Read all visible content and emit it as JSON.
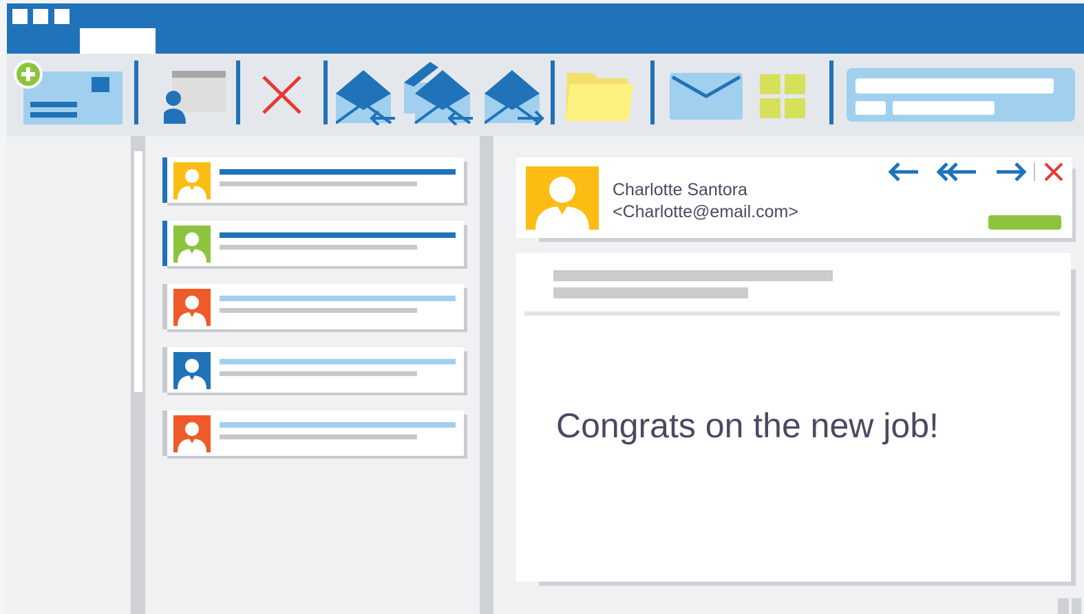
{
  "colors": {
    "chrome_blue": "#2072b9",
    "light_blue": "#a1d0ee",
    "unread_line": "#2072b9",
    "read_line": "#a1d0ee",
    "avatar_yellow": "#fbbd14",
    "avatar_green": "#8cc43e",
    "avatar_orange": "#ef5a2a",
    "avatar_blue": "#2072b9",
    "close_red": "#e53935",
    "folder_yellow": "#fdf17f",
    "apps_green": "#d7e05a"
  },
  "toolbar": {
    "icons": [
      "new-email-icon",
      "contacts-icon",
      "delete-icon",
      "reply-icon",
      "reply-all-icon",
      "forward-icon",
      "folder-icon",
      "send-receive-icon",
      "apps-icon"
    ]
  },
  "messages": [
    {
      "avatar_color": "#fbbd14",
      "state": "unread"
    },
    {
      "avatar_color": "#8cc43e",
      "state": "unread"
    },
    {
      "avatar_color": "#ef5a2a",
      "state": "read"
    },
    {
      "avatar_color": "#2072b9",
      "state": "read"
    },
    {
      "avatar_color": "#ef5a2a",
      "state": "read"
    }
  ],
  "reading_pane": {
    "sender_name": "Charlotte Santora",
    "sender_email": "<Charlotte@email.com>",
    "body": "Congrats on the new job!",
    "nav_icons": [
      "reply-arrow-icon",
      "reply-all-arrow-icon",
      "forward-arrow-icon",
      "close-icon"
    ]
  }
}
